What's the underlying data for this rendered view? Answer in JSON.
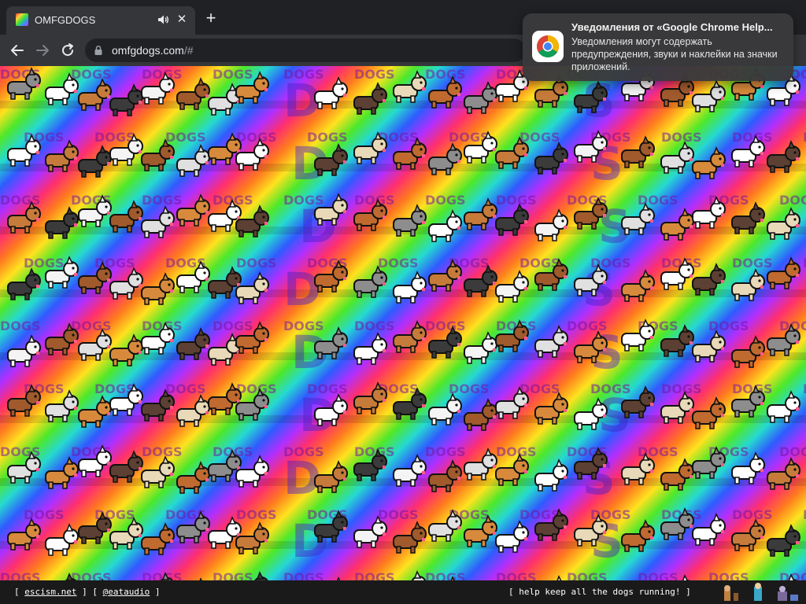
{
  "browser": {
    "tab": {
      "title": "OMFGDOGS",
      "favicon": "omfgdogs-favicon",
      "audio_icon": "speaker-icon",
      "close_glyph": "✕"
    },
    "new_tab_glyph": "+",
    "nav": {
      "back_icon": "arrow-left-icon",
      "forward_icon": "arrow-right-icon",
      "reload_icon": "reload-icon"
    },
    "address": {
      "host": "omfgdogs.com",
      "rest": "/#",
      "lock_icon": "lock-icon"
    }
  },
  "page": {
    "background": "rainbow-gradient",
    "repeated_text": "DOGS",
    "scene": "rows of running pixel-art dogs"
  },
  "footer": {
    "left": {
      "open": "[ ",
      "link1": "escism.net",
      "mid": " ] [ ",
      "link2": "@eataudio",
      "close": " ]"
    },
    "right": {
      "text": "[ help keep all the dogs running! ]"
    }
  },
  "notification": {
    "title": "Уведомления от «Google Chrome Help...",
    "body": "Уведомления могут содержать предупреждения, звуки и наклейки на значки приложений.",
    "icon": "chrome-icon"
  },
  "colors": {
    "tabstrip": "#202124",
    "toolbar": "#35363a",
    "omnibox": "#202124",
    "notification_bg": "#3a3a3c",
    "footer_bg": "#1a1a1a"
  }
}
